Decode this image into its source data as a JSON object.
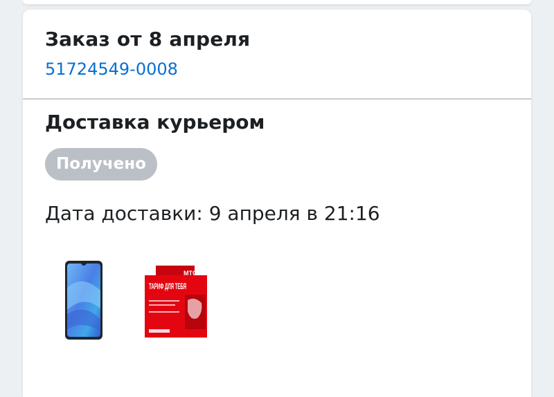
{
  "order": {
    "title": "Заказ от 8 апреля",
    "number": "51724549-0008"
  },
  "delivery": {
    "method": "Доставка курьером",
    "status": "Получено",
    "date_text": "Дата доставки: 9 апреля в 21:16"
  },
  "products": [
    {
      "name": "phone-image"
    },
    {
      "name": "sim-card-pack-image",
      "brand_text": "МТС",
      "pack_text": "ТАРИФ ДЛЯ ТЕБЯ"
    }
  ],
  "colors": {
    "link": "#0a6fd1",
    "badge": "#bbc0c6",
    "brand_red": "#e30611"
  }
}
